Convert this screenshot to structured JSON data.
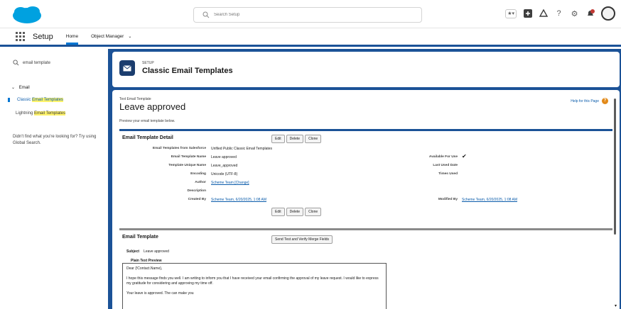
{
  "header": {
    "search_placeholder": "Search Setup",
    "icons": [
      "favorites-star-icon",
      "favorites-dropdown-icon",
      "app-launcher-plus-icon",
      "trailhead-icon",
      "help-icon",
      "gear-icon",
      "notifications-bell-icon",
      "avatar"
    ]
  },
  "nav": {
    "app_name": "Setup",
    "tabs": [
      {
        "label": "Home",
        "active": true
      },
      {
        "label": "Object Manager",
        "active": false
      }
    ]
  },
  "sidebar": {
    "quickfind_value": "email template",
    "tree_head": "Email",
    "items": [
      {
        "prefix": "Classic ",
        "highlight": "Email Templates",
        "selected": true
      },
      {
        "prefix": "Lightning ",
        "highlight": "Email Templates",
        "selected": false
      }
    ],
    "help_text": "Didn't find what you're looking for? Try using Global Search."
  },
  "page_header": {
    "eyebrow": "SETUP",
    "title": "Classic Email Templates"
  },
  "content": {
    "eyebrow": "Text Email Template",
    "title": "Leave approved",
    "help_link": "Help for this Page",
    "preview_note": "Preview your email template below.",
    "detail_title": "Email Template Detail",
    "buttons": [
      "Edit",
      "Delete",
      "Clone"
    ],
    "fields_left": [
      {
        "label": "Email Templates from Salesforce",
        "value": "Unfiled Public Classic Email Templates",
        "link": false
      },
      {
        "label": "Email Template Name",
        "value": "Leave approved",
        "link": false
      },
      {
        "label": "Template Unique Name",
        "value": "Leave_approved",
        "link": false
      },
      {
        "label": "Encoding",
        "value": "Unicode (UTF-8)",
        "link": false
      },
      {
        "label": "Author",
        "value": "Scheme Team [Change]",
        "link": true
      },
      {
        "label": "Description",
        "value": "",
        "link": false
      },
      {
        "label": "Created By",
        "value": "Scheme Team, 6/20/2025, 1:08 AM",
        "link": true
      }
    ],
    "fields_right": [
      {
        "label": "Available For Use",
        "value": "✔"
      },
      {
        "label": "Last Used Date",
        "value": ""
      },
      {
        "label": "Times Used",
        "value": ""
      },
      {
        "label": "Modified By",
        "value": "Scheme Team, 6/20/2025, 1:08 AM"
      }
    ],
    "template_title": "Email Template",
    "send_test_button": "Send Test and Verify Merge Fields",
    "subject_label": "Subject",
    "subject_value": "Leave approved",
    "plain_text_title": "Plain Text Preview",
    "body_lines": [
      "Dear {!Contact.Name},",
      "I hope this message finds you well. I am writing to inform you that I have received your email confirming the approval of my leave request. I would like to express my gratitude for considering and approving my time off.",
      "Your leave is approved. The can make you"
    ]
  },
  "colors": {
    "brand_blue": "#1b5297",
    "link_blue": "#0b5cab",
    "salesforce_cloud": "#00a1e0",
    "highlight_yellow": "#fff36b"
  }
}
